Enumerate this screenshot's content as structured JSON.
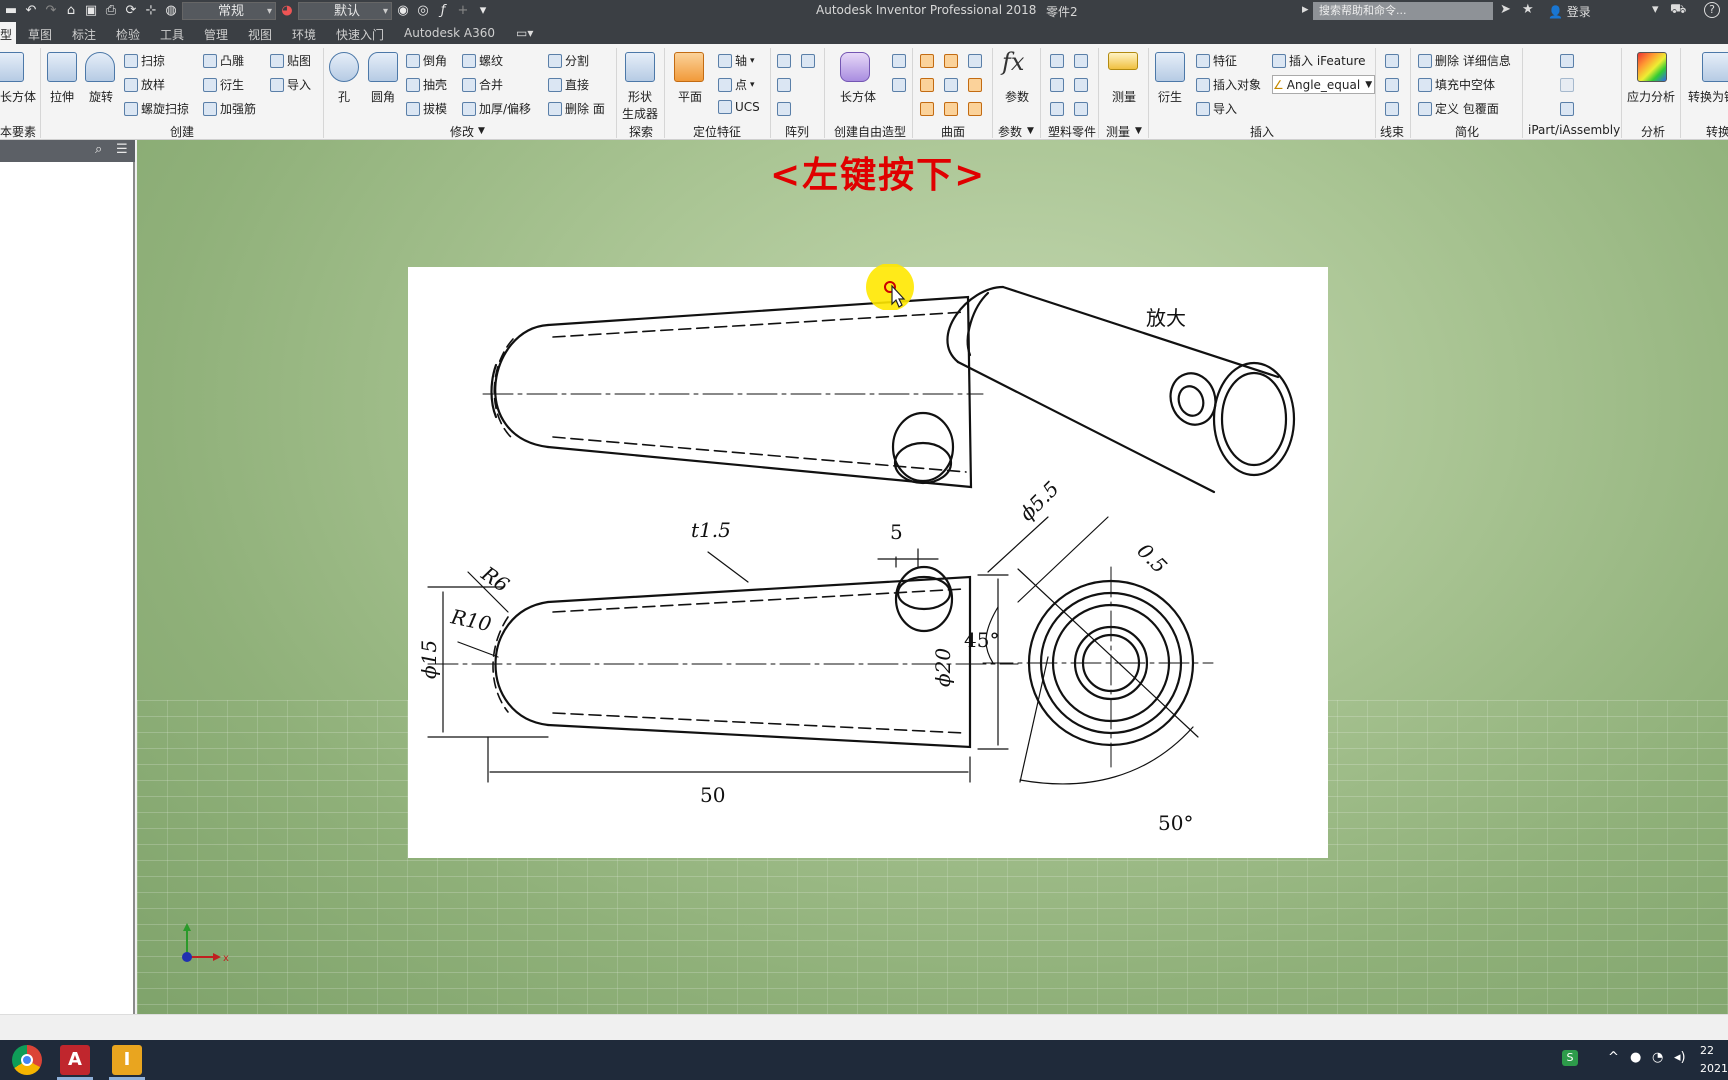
{
  "app": {
    "title": "Autodesk Inventor Professional 2018",
    "document": "零件2",
    "appearance_combo": "常规",
    "material_combo": "默认",
    "help_search_placeholder": "搜索帮助和命令...",
    "sign_in": "登录",
    "help": "?"
  },
  "tabs": [
    "型",
    "草图",
    "标注",
    "检验",
    "工具",
    "管理",
    "视图",
    "环境",
    "快速入门",
    "Autodesk A360"
  ],
  "ribbon": {
    "basic": {
      "box": "长方体",
      "group": "本要素"
    },
    "create": {
      "group": "创建",
      "extrude": "拉伸",
      "revolve": "旋转",
      "sweep": "扫掠",
      "loft": "放样",
      "coil": "螺旋扫掠",
      "emboss": "凸雕",
      "derive": "衍生",
      "rib": "加强筋",
      "decal": "贴图",
      "import": "导入"
    },
    "modify": {
      "group": "修改",
      "hole": "孔",
      "fillet": "圆角",
      "chamfer": "倒角",
      "shell": "抽壳",
      "draft": "拔模",
      "thread": "螺纹",
      "combine": "合并",
      "thicken": "加厚/偏移",
      "split": "分割",
      "direct": "直接",
      "delete_face": "删除 面"
    },
    "explore": {
      "group": "探索",
      "shape_gen_1": "形状",
      "shape_gen_2": "生成器"
    },
    "work": {
      "group": "定位特征",
      "plane": "平面",
      "axis": "轴",
      "point": "点",
      "ucs": "UCS"
    },
    "pattern": {
      "group": "阵列"
    },
    "freeform": {
      "group": "创建自由造型",
      "box": "长方体"
    },
    "surface": {
      "group": "曲面"
    },
    "params": {
      "group": "参数",
      "label": "参数",
      "fx": "fx"
    },
    "plastic": {
      "group": "塑料零件"
    },
    "measure": {
      "group": "测量",
      "label": "测量"
    },
    "insert": {
      "group": "插入",
      "derive": "衍生",
      "feature": "特征",
      "insert_object": "插入对象",
      "import": "导入",
      "ifeature": "插入 iFeature",
      "angle_combo": "Angle_equal"
    },
    "harness": {
      "group": "线束"
    },
    "simplify": {
      "group": "简化",
      "remove_details": "删除 详细信息",
      "fill_voids": "填充中空体",
      "define_envelope": "定义 包覆面"
    },
    "ipart": {
      "group": "iPart/iAssembly"
    },
    "analysis": {
      "group": "分析",
      "stress": "应力分析"
    },
    "convert": {
      "group": "转换",
      "label": "转换为钣"
    }
  },
  "viewport": {
    "hint": "<左键按下>",
    "triad_x": "x"
  },
  "drawing": {
    "magnify": "放大",
    "dim_t": "t1.5",
    "dim_5": "5",
    "dim_r6": "R6",
    "dim_r10": "R10",
    "dim_phi15": "ϕ15",
    "dim_phi20": "ϕ20",
    "dim_50": "50",
    "dim_phi55": "ϕ5.5",
    "dim_05": "0.5",
    "dim_45": "45°",
    "dim_50deg": "50°"
  },
  "taskbar": {
    "clock_time": "22",
    "clock_date": "2021"
  },
  "colors": {
    "hint": "#e00000",
    "titlebar": "#3b3f44",
    "taskbar": "#1f2a3a"
  }
}
